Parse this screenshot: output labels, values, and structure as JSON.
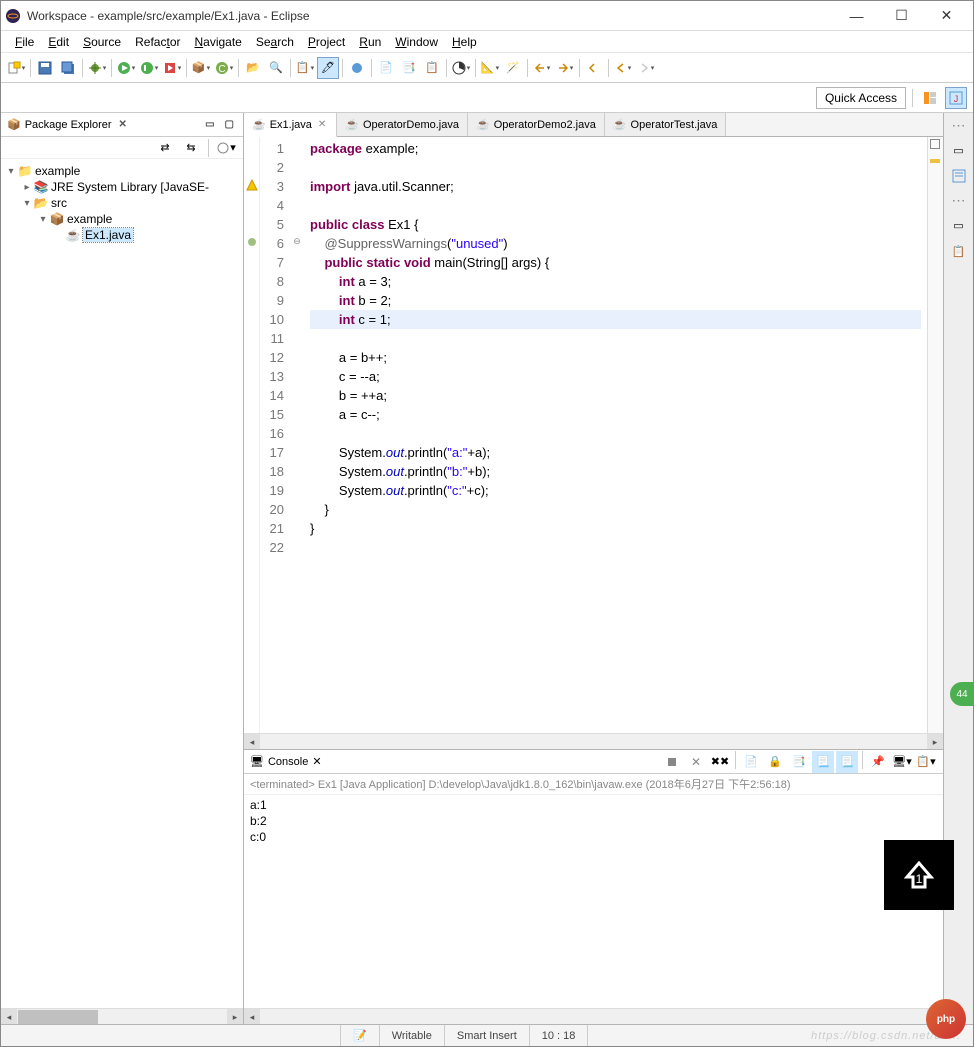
{
  "window": {
    "title": "Workspace - example/src/example/Ex1.java - Eclipse",
    "controls": {
      "min": "—",
      "max": "☐",
      "close": "✕"
    }
  },
  "menu": [
    {
      "label": "File",
      "accel": "F"
    },
    {
      "label": "Edit",
      "accel": "E"
    },
    {
      "label": "Source",
      "accel": "S"
    },
    {
      "label": "Refactor",
      "accel": "t"
    },
    {
      "label": "Navigate",
      "accel": "N"
    },
    {
      "label": "Search",
      "accel": "a"
    },
    {
      "label": "Project",
      "accel": "P"
    },
    {
      "label": "Run",
      "accel": "R"
    },
    {
      "label": "Window",
      "accel": "W"
    },
    {
      "label": "Help",
      "accel": "H"
    }
  ],
  "quick_access": "Quick Access",
  "package_explorer": {
    "title": "Package Explorer",
    "tree": [
      {
        "label": "example",
        "icon": "project",
        "depth": 0,
        "expanded": true
      },
      {
        "label": "JRE System Library [JavaSE-",
        "icon": "library",
        "depth": 1,
        "expanded": false
      },
      {
        "label": "src",
        "icon": "src",
        "depth": 1,
        "expanded": true
      },
      {
        "label": "example",
        "icon": "package",
        "depth": 2,
        "expanded": true
      },
      {
        "label": "Ex1.java",
        "icon": "java",
        "depth": 3,
        "selected": true
      }
    ]
  },
  "editor": {
    "tabs": [
      {
        "label": "Ex1.java",
        "icon": "java",
        "active": true
      },
      {
        "label": "OperatorDemo.java",
        "icon": "java"
      },
      {
        "label": "OperatorDemo2.java",
        "icon": "java"
      },
      {
        "label": "OperatorTest.java",
        "icon": "java"
      }
    ],
    "lines": [
      {
        "n": 1,
        "html": "<span class='kw'>package</span> example;"
      },
      {
        "n": 2,
        "html": ""
      },
      {
        "n": 3,
        "html": "<span class='kw'>import</span> java.util.Scanner;",
        "mark": "warn"
      },
      {
        "n": 4,
        "html": ""
      },
      {
        "n": 5,
        "html": "<span class='kw'>public</span> <span class='kw'>class</span> Ex1 {"
      },
      {
        "n": 6,
        "html": "    <span class='ann'>@SuppressWarnings</span>(<span class='str'>\"unused\"</span>)",
        "mark": "ann",
        "fold": "⊖"
      },
      {
        "n": 7,
        "html": "    <span class='kw'>public</span> <span class='kw'>static</span> <span class='kw'>void</span> main(String[] args) {"
      },
      {
        "n": 8,
        "html": "        <span class='kw'>int</span> a = 3;"
      },
      {
        "n": 9,
        "html": "        <span class='kw'>int</span> b = 2;"
      },
      {
        "n": 10,
        "html": "        <span class='kw'>int</span> c = 1;",
        "hl": true
      },
      {
        "n": 11,
        "html": ""
      },
      {
        "n": 12,
        "html": "        a = b++;"
      },
      {
        "n": 13,
        "html": "        c = --a;"
      },
      {
        "n": 14,
        "html": "        b = ++a;"
      },
      {
        "n": 15,
        "html": "        a = c--;"
      },
      {
        "n": 16,
        "html": ""
      },
      {
        "n": 17,
        "html": "        System.<span class='field'>out</span>.println(<span class='str'>\"a:\"</span>+a);"
      },
      {
        "n": 18,
        "html": "        System.<span class='field'>out</span>.println(<span class='str'>\"b:\"</span>+b);"
      },
      {
        "n": 19,
        "html": "        System.<span class='field'>out</span>.println(<span class='str'>\"c:\"</span>+c);"
      },
      {
        "n": 20,
        "html": "    }"
      },
      {
        "n": 21,
        "html": "}"
      },
      {
        "n": 22,
        "html": ""
      }
    ]
  },
  "console": {
    "title": "Console",
    "info": "<terminated> Ex1 [Java Application] D:\\develop\\Java\\jdk1.8.0_162\\bin\\javaw.exe (2018年6月27日 下午2:56:18)",
    "output": [
      "a:1",
      "b:2",
      "c:0"
    ]
  },
  "status": {
    "writable": "Writable",
    "insert": "Smart Insert",
    "pos": "10 : 18",
    "watermark": "https://blog.csdn.net/an..."
  },
  "badge": "44",
  "avatar_text": "php"
}
